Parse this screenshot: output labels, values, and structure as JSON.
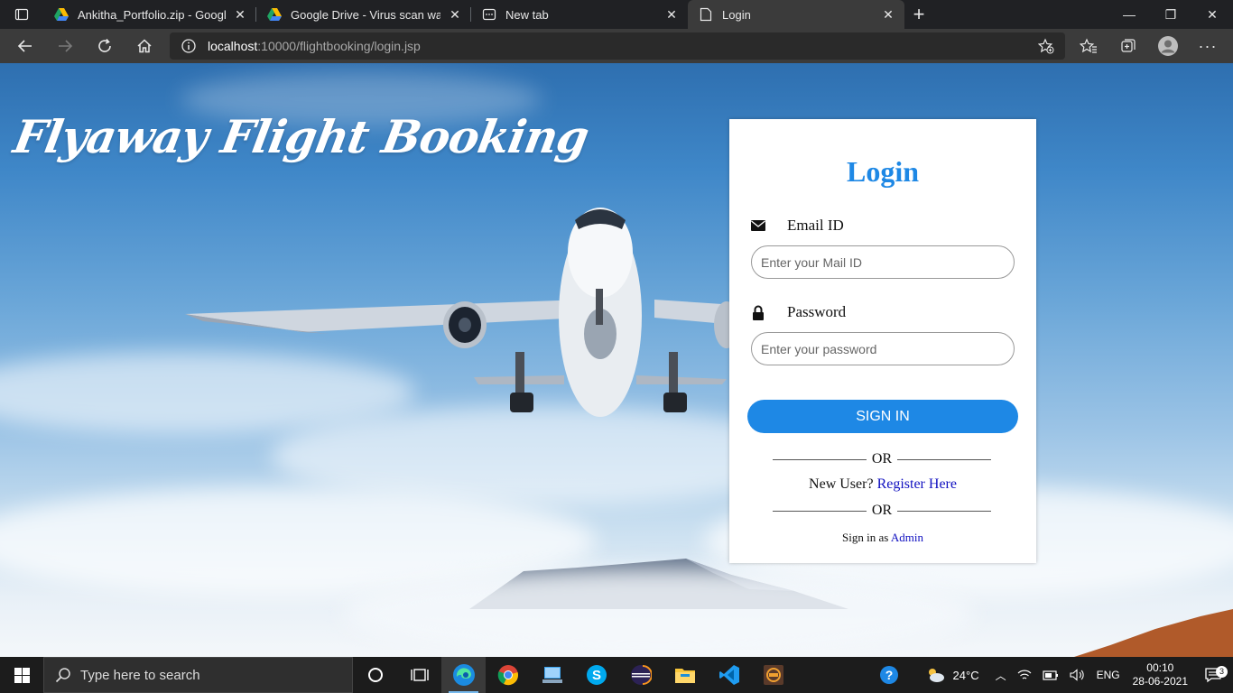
{
  "browser": {
    "tabs": [
      {
        "title": "Ankitha_Portfolio.zip - Google Dr",
        "icon": "google-drive-icon"
      },
      {
        "title": "Google Drive - Virus scan warnin",
        "icon": "google-drive-icon"
      },
      {
        "title": "New tab",
        "icon": "new-tab-icon"
      },
      {
        "title": "Login",
        "icon": "page-icon",
        "active": true
      }
    ],
    "address": {
      "host": "localhost",
      "path": ":10000/flightbooking/login.jsp"
    }
  },
  "page": {
    "brand_title": "Flyaway Flight Booking",
    "login": {
      "heading": "Login",
      "email_label": "Email ID",
      "email_placeholder": "Enter your Mail ID",
      "password_label": "Password",
      "password_placeholder": "Enter your password",
      "signin_label": "SIGN IN",
      "or_text": "OR",
      "new_user_text": "New User?",
      "register_link": "Register Here",
      "signin_as_text": "Sign in as",
      "admin_link": "Admin"
    },
    "colors": {
      "accent": "#1e88e5",
      "link": "#1010c0"
    }
  },
  "taskbar": {
    "search_placeholder": "Type here to search",
    "weather": "24°C",
    "language": "ENG",
    "time": "00:10",
    "date": "28-06-2021",
    "notifications": "3"
  }
}
